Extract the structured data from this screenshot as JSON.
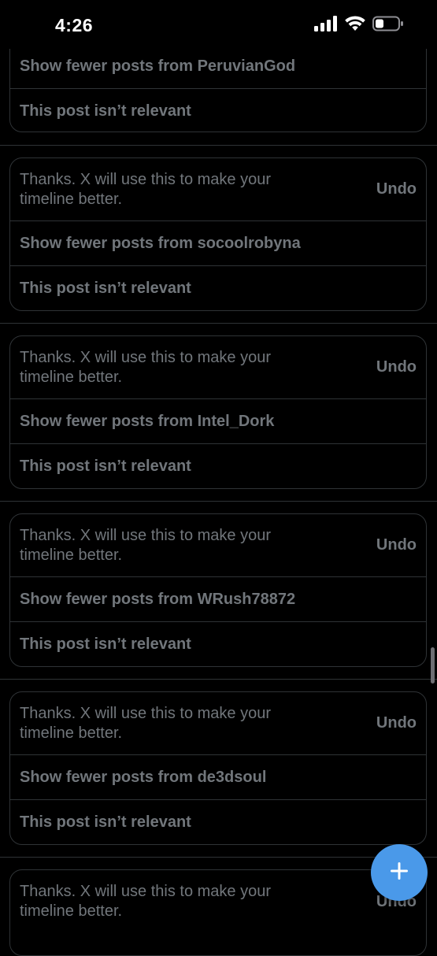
{
  "status_bar": {
    "time": "4:26",
    "signal_icon": "cellular-signal-icon",
    "wifi_icon": "wifi-icon",
    "battery_icon": "battery-low-icon"
  },
  "cards": [
    {
      "show_fewer": "Show fewer posts from PeruvianGod",
      "not_relevant": "This post isn’t relevant"
    },
    {
      "thanks": "Thanks. X will use this to make your timeline better.",
      "undo": "Undo",
      "show_fewer": "Show fewer posts from socoolrobyna",
      "not_relevant": "This post isn’t relevant"
    },
    {
      "thanks": "Thanks. X will use this to make your timeline better.",
      "undo": "Undo",
      "show_fewer": "Show fewer posts from Intel_Dork",
      "not_relevant": "This post isn’t relevant"
    },
    {
      "thanks": "Thanks. X will use this to make your timeline better.",
      "undo": "Undo",
      "show_fewer": "Show fewer posts from WRush78872",
      "not_relevant": "This post isn’t relevant"
    },
    {
      "thanks": "Thanks. X will use this to make your timeline better.",
      "undo": "Undo",
      "show_fewer": "Show fewer posts from de3dsoul",
      "not_relevant": "This post isn’t relevant"
    },
    {
      "thanks": "Thanks. X will use this to make your timeline better.",
      "undo": "Undo"
    }
  ],
  "fab": {
    "icon": "plus-icon",
    "color": "#4a99e9"
  },
  "colors": {
    "background": "#000000",
    "border": "#2f3336",
    "muted_text": "#71767b",
    "accent": "#4a99e9"
  }
}
